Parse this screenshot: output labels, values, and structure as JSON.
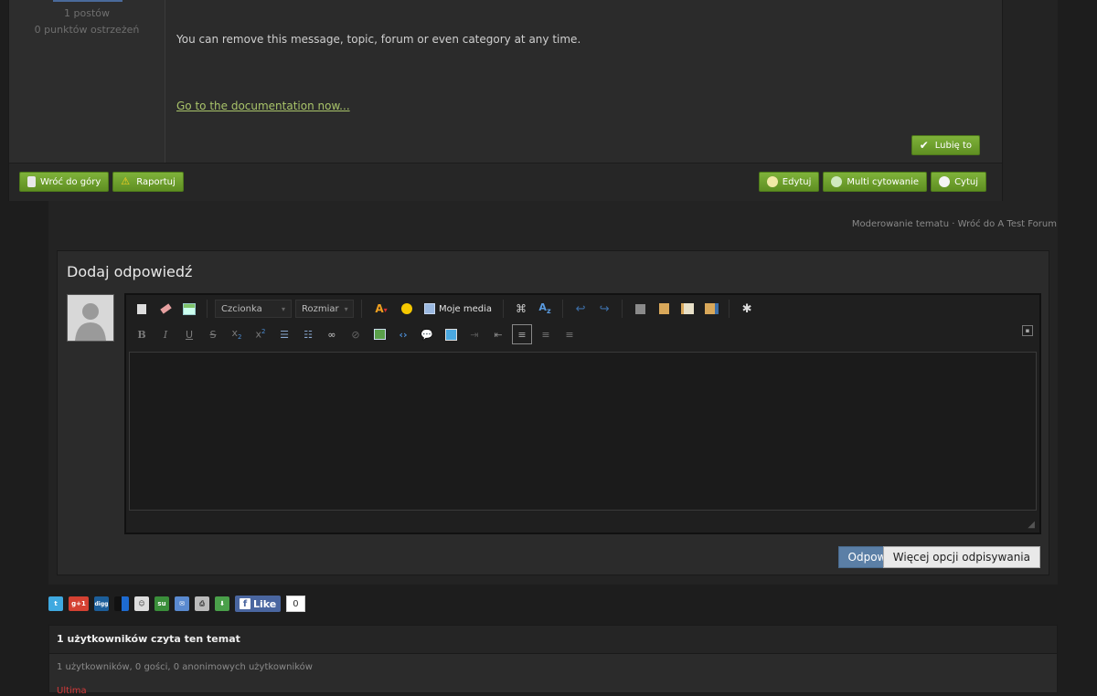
{
  "post": {
    "author_posts": "1 postów",
    "author_warnings": "0 punktów ostrzeżeń",
    "body_text": "You can remove this message, topic, forum or even category at any time.",
    "doc_link": "Go to the documentation now...",
    "like_label": "Lubię to",
    "footer": {
      "back_top": "Wróć do góry",
      "report": "Raportuj",
      "edit": "Edytuj",
      "multi_quote": "Multi cytowanie",
      "quote": "Cytuj"
    }
  },
  "moderation": {
    "moderate": "Moderowanie tematu",
    "sep": "·",
    "back_to_forum": "Wróć do A Test Forum"
  },
  "reply": {
    "title": "Dodaj odpowiedź",
    "font_combo": "Czcionka",
    "size_combo": "Rozmiar",
    "media_label": "Moje media",
    "submit": "Odpowiedz",
    "more_options": "Więcej opcji odpisywania"
  },
  "share": {
    "gplus": "g+1",
    "digg": "digg",
    "like": "Like",
    "like_count": "0"
  },
  "viewers": {
    "heading": "1 użytkowników czyta ten temat",
    "summary": "1 użytkowników, 0 gości, 0 anonimowych użytkowników",
    "user": "Ultima"
  },
  "colors": {
    "green_button": "#6fa22e",
    "primary_button": "#5b7fa6",
    "link_green": "#a9c46a",
    "user_red": "#d23a3a"
  }
}
